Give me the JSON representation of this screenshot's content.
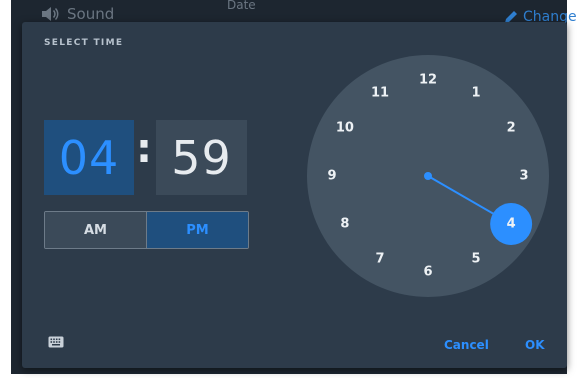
{
  "background": {
    "sound_label": "Sound",
    "top_partial_text": "Date",
    "change_label": "Change",
    "icons": [
      "speaker-icon",
      "pencil-icon"
    ]
  },
  "dialog": {
    "title": "SELECT TIME",
    "hour": "04",
    "separator": ":",
    "minute": "59",
    "am_label": "AM",
    "pm_label": "PM",
    "period_selected": "PM",
    "cancel_label": "Cancel",
    "ok_label": "OK",
    "keyboard_icon": "keyboard-icon"
  },
  "clock": {
    "numbers": [
      "12",
      "1",
      "2",
      "3",
      "4",
      "5",
      "6",
      "7",
      "8",
      "9",
      "10",
      "11"
    ],
    "selected": "4"
  },
  "colors": {
    "accent": "#2c8fff",
    "dialog_bg": "#2d3b4a",
    "clock_face": "#445463",
    "selected_bg": "#1f4f7e"
  }
}
